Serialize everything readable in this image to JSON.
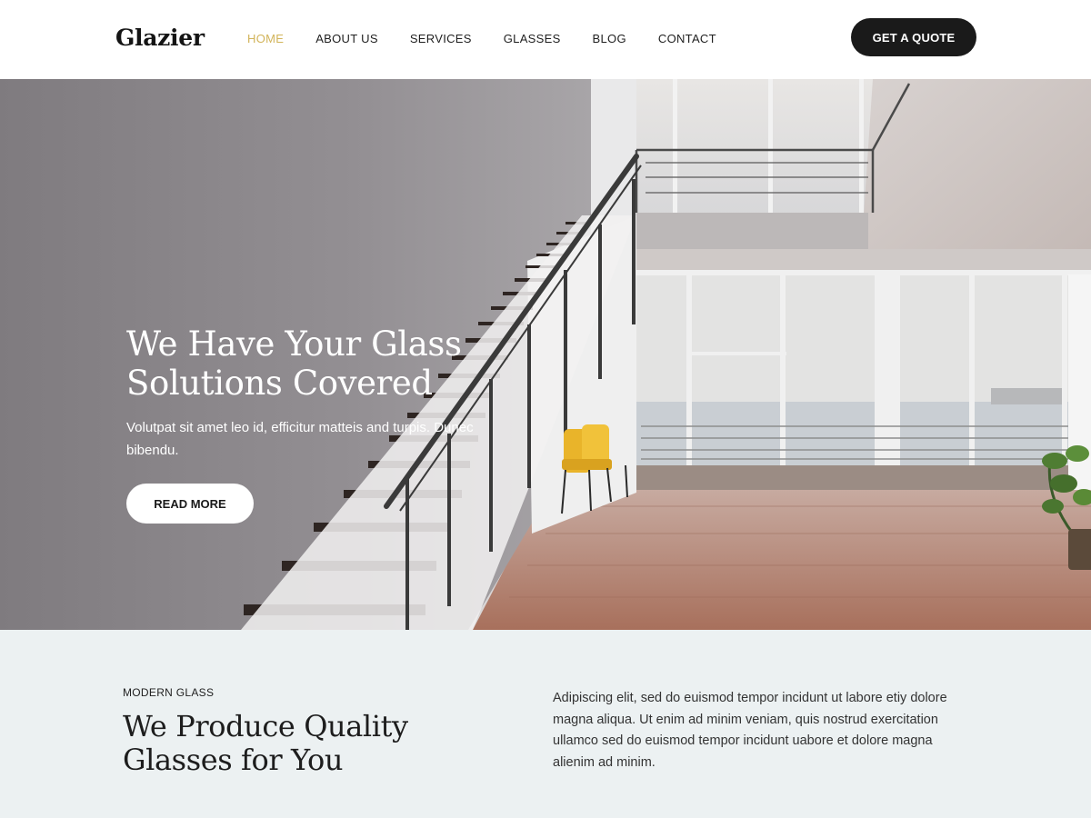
{
  "header": {
    "logo": "Glazier",
    "nav": [
      "HOME",
      "ABOUT US",
      "SERVICES",
      "GLASSES",
      "BLOG",
      "CONTACT"
    ],
    "active_nav": "HOME",
    "cta": "GET A QUOTE"
  },
  "hero": {
    "title": "We Have Your Glass Solutions Covered",
    "text": "Volutpat sit amet leo id, efficitur matteis and turpis. Dunec bibendu.",
    "button": "READ MORE"
  },
  "about": {
    "eyebrow": "MODERN GLASS",
    "title": "We Produce Quality Glasses for You",
    "text": "Adipiscing elit, sed do euismod tempor incidunt ut labore etiy dolore magna aliqua. Ut enim ad minim veniam, quis nostrud exercitation ullamco sed do euismod tempor incidunt uabore et dolore magna alienim ad minim."
  },
  "colors": {
    "accent": "#d2b45a",
    "dark": "#1a1a1a",
    "section_bg": "#ecf1f2"
  }
}
